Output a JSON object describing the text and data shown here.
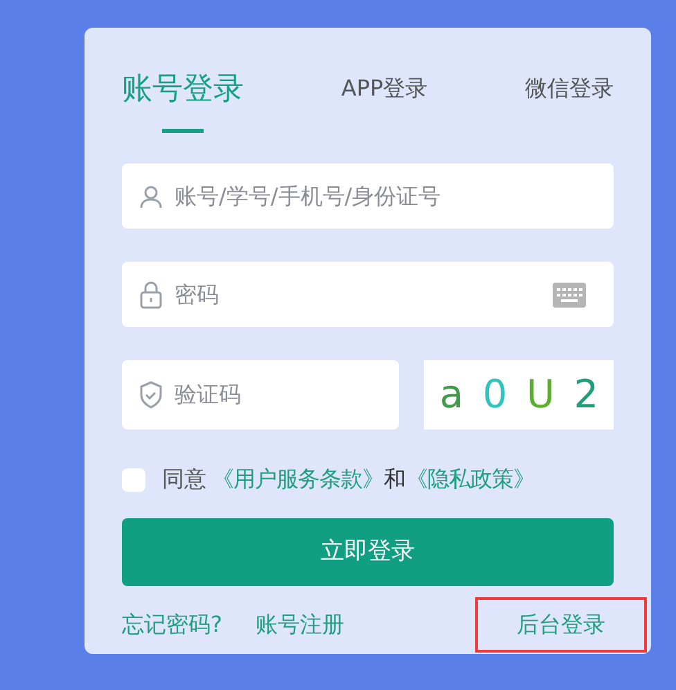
{
  "tabs": [
    {
      "label": "账号登录",
      "selected": true
    },
    {
      "label": "APP登录",
      "selected": false
    },
    {
      "label": "微信登录",
      "selected": false
    }
  ],
  "fields": [
    {
      "kind": "user",
      "placeholder": "账号/学号/手机号/身份证号"
    },
    {
      "kind": "password",
      "placeholder": "密码"
    }
  ],
  "captcha": {
    "placeholder": "验证码",
    "code": [
      {
        "char": "a",
        "color": "#3f9a4a"
      },
      {
        "char": "0",
        "color": "#2fc4c0"
      },
      {
        "char": "U",
        "color": "#5cae2e"
      },
      {
        "char": "2",
        "color": "#1f9e7a"
      }
    ]
  },
  "agreement": {
    "checked": false,
    "prefix": "同意",
    "terms": "《用户服务条款》",
    "joiner": "和",
    "privacy": "《隐私政策》"
  },
  "submit": "立即登录",
  "links": [
    {
      "label": "忘记密码?",
      "highlighted": false
    },
    {
      "label": "账号注册",
      "highlighted": false
    },
    {
      "label": "后台登录",
      "highlighted": true
    }
  ]
}
